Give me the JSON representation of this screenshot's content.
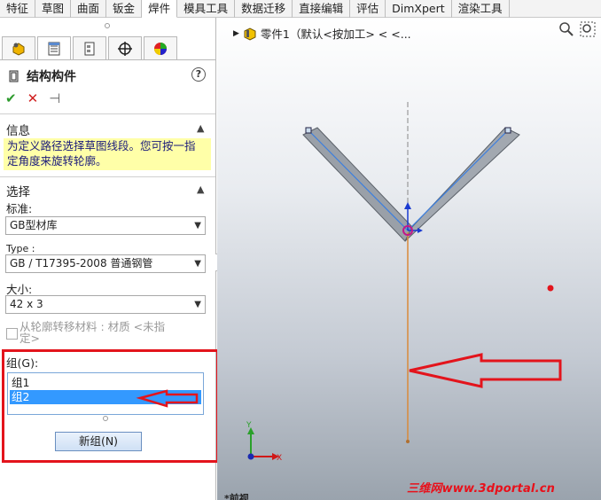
{
  "ribbon_tabs": [
    "特征",
    "草图",
    "曲面",
    "钣金",
    "焊件",
    "模具工具",
    "数据迁移",
    "直接编辑",
    "评估",
    "DimXpert",
    "渲染工具"
  ],
  "property_manager": {
    "title": "结构构件",
    "help": "?",
    "ok": "✔",
    "cancel": "✕",
    "pin": "⊣"
  },
  "info_section": {
    "heading": "信息",
    "text_line1": "为定义路径选择草图线段。您可按一指",
    "text_line2": "定角度来旋转轮廓。"
  },
  "selection_section": {
    "heading": "选择",
    "standard_label": "标准:",
    "standard_value": "GB型材库",
    "type_label": "Type :",
    "type_value": "GB / T17395-2008 普通钢管",
    "size_label": "大小:",
    "size_value": "42 x 3",
    "transfer_label_line1": "从轮廓转移材料 : 材质 <未指",
    "transfer_label_line2": "定>"
  },
  "groups": {
    "label": "组(G):",
    "items": [
      "组1",
      "组2"
    ],
    "selected_index": 1,
    "new_group_button": "新组(N)"
  },
  "viewport": {
    "doc_title": "零件1（默认<按加工> < <...",
    "axis_y": "Y",
    "axis_x": "X",
    "comment": "*前视",
    "watermark": "三维网www.3dportal.cn"
  },
  "colors": {
    "annotation_red": "#e3141c",
    "selection_blue": "#3399ff",
    "path_orange": "#d98a3a"
  }
}
